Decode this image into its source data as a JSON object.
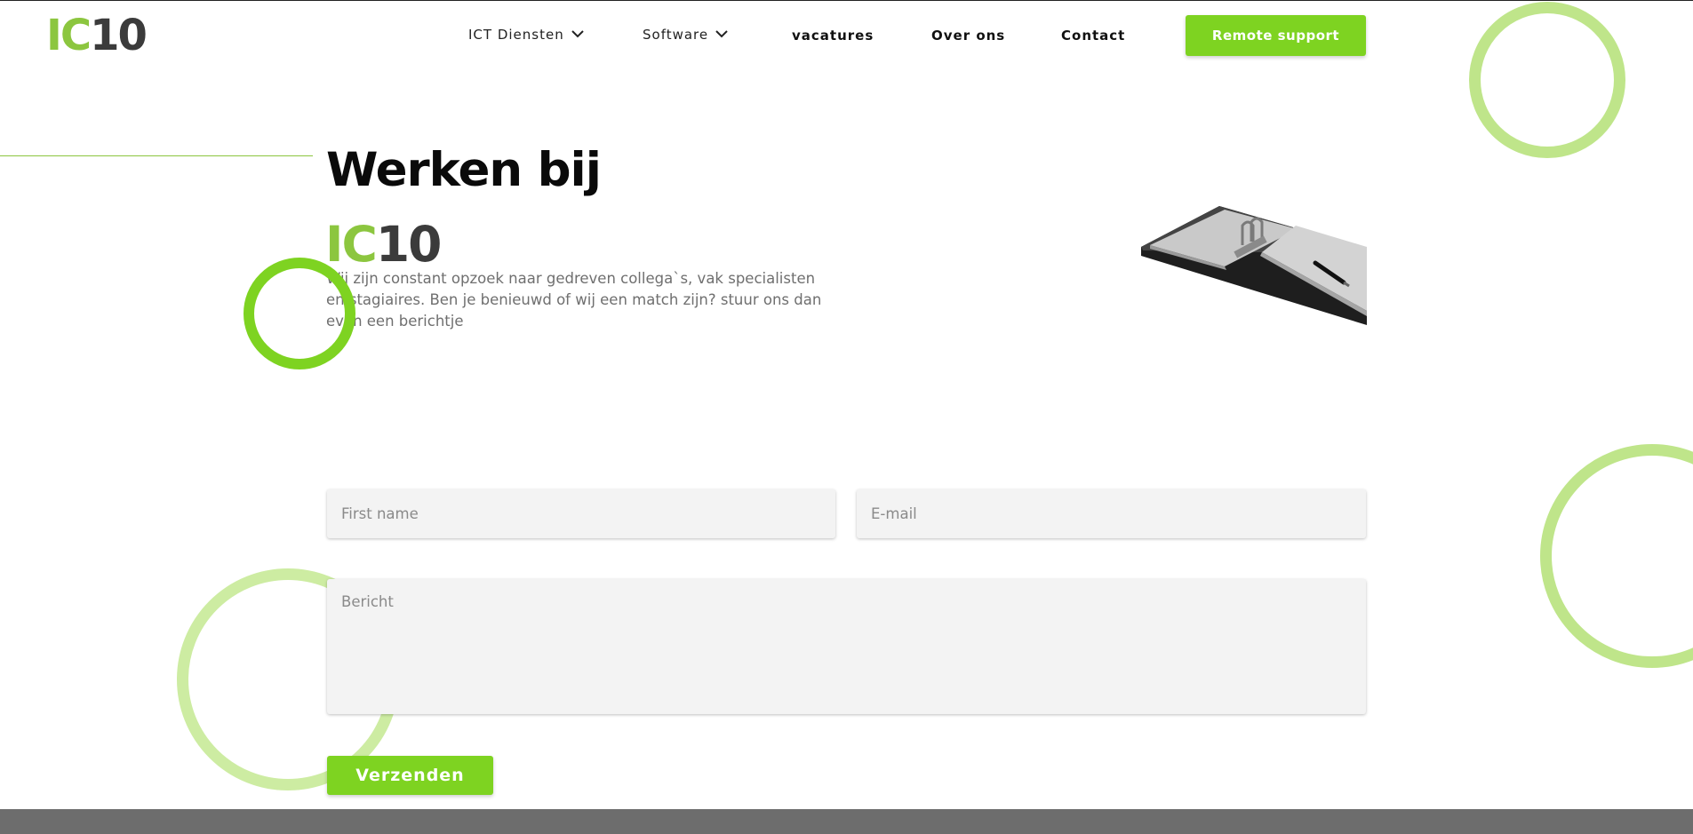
{
  "header": {
    "logo": {
      "part1": "IC",
      "part2": "10"
    },
    "nav": [
      {
        "label": "ICT Diensten",
        "has_dropdown": true
      },
      {
        "label": "Software",
        "has_dropdown": true
      },
      {
        "label": "vacatures",
        "has_dropdown": false
      },
      {
        "label": "Over ons",
        "has_dropdown": false
      },
      {
        "label": "Contact",
        "has_dropdown": false
      }
    ],
    "cta_label": "Remote support"
  },
  "hero": {
    "title": "Werken bij",
    "logo": {
      "part1": "IC",
      "part2": "10"
    },
    "intro": "Wij zijn constant opzoek naar gedreven collega`s, vak specialisten en stagiaires. Ben je benieuwd of wij een match zijn? stuur ons dan even een berichtje",
    "image_icon": "binder-illustration-icon"
  },
  "form": {
    "name_placeholder": "First name",
    "email_placeholder": "E-mail",
    "message_placeholder": "Bericht",
    "submit_label": "Verzenden"
  },
  "colors": {
    "accent": "#7ed321",
    "logo_green": "#8cc63f",
    "logo_dark": "#3b3b3b",
    "ring_light": "#bfe58a",
    "footer": "#6d6d6d"
  }
}
